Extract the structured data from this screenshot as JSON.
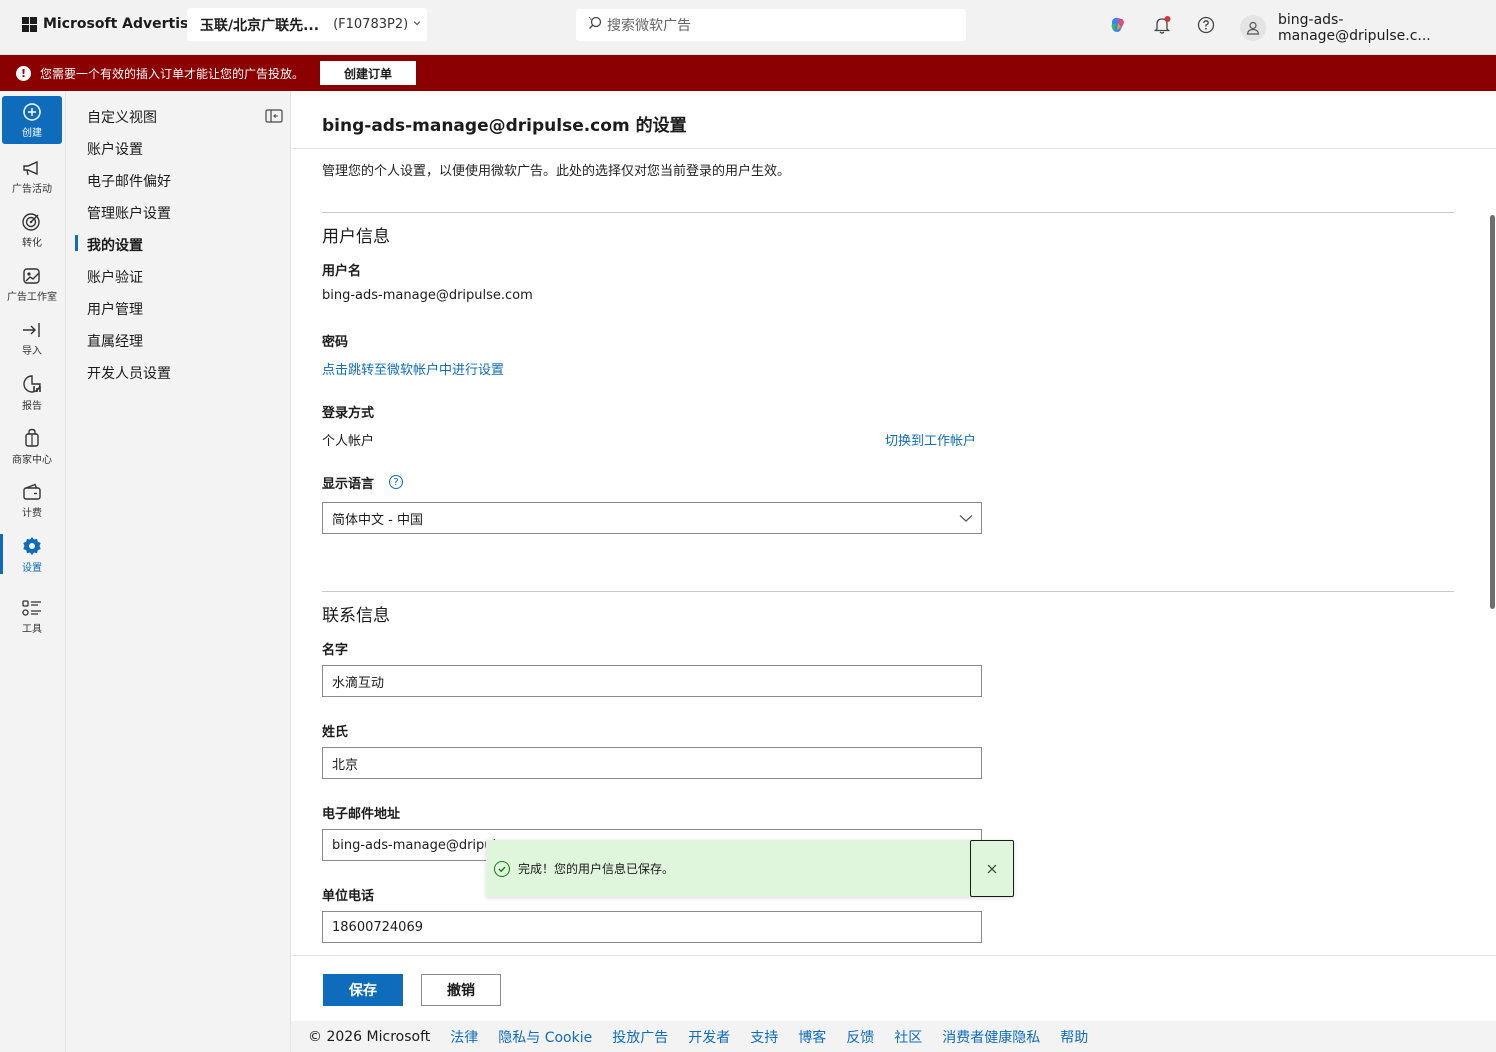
{
  "topbar": {
    "brand": "Microsoft Advertising",
    "account_name": "玉联/北京广联先...",
    "account_id": "(F10783P2)",
    "search_placeholder": "搜索微软广告",
    "user_email": "bing-ads-manage@dripulse.c..."
  },
  "alert": {
    "message": "您需要一个有效的插入订单才能让您的广告投放。",
    "button": "创建订单",
    "color": "#8b0000"
  },
  "rail": {
    "items": [
      {
        "label": "创建",
        "icon": "plus-circle-icon"
      },
      {
        "label": "广告活动",
        "icon": "megaphone-icon"
      },
      {
        "label": "转化",
        "icon": "target-icon"
      },
      {
        "label": "广告工作室",
        "icon": "studio-icon"
      },
      {
        "label": "导入",
        "icon": "import-icon"
      },
      {
        "label": "报告",
        "icon": "report-icon"
      },
      {
        "label": "商家中心",
        "icon": "shopping-bag-icon"
      },
      {
        "label": "计费",
        "icon": "wallet-icon"
      },
      {
        "label": "设置",
        "icon": "gear-icon"
      },
      {
        "label": "工具",
        "icon": "tools-icon"
      }
    ]
  },
  "subnav": {
    "items": [
      "自定义视图",
      "账户设置",
      "电子邮件偏好",
      "管理账户设置",
      "我的设置",
      "账户验证",
      "用户管理",
      "直属经理",
      "开发人员设置"
    ],
    "active": "我的设置"
  },
  "page": {
    "title": "bing-ads-manage@dripulse.com 的设置",
    "description": "管理您的个人设置，以便使用微软广告。此处的选择仅对您当前登录的用户生效。"
  },
  "user_info": {
    "section_title": "用户信息",
    "username_label": "用户名",
    "username_value": "bing-ads-manage@dripulse.com",
    "password_label": "密码",
    "password_link": "点击跳转至微软帐户中进行设置",
    "login_label": "登录方式",
    "login_value": "个人帐户",
    "login_switch": "切换到工作帐户",
    "language_label": "显示语言",
    "language_value": "简体中文 - 中国"
  },
  "contact_info": {
    "section_title": "联系信息",
    "first_name_label": "名字",
    "first_name_value": "水滴互动",
    "last_name_label": "姓氏",
    "last_name_value": "北京",
    "email_label": "电子邮件地址",
    "email_value": "bing-ads-manage@dripulse.com",
    "phone_label": "单位电话",
    "phone_value": "18600724069"
  },
  "toast": {
    "message": "完成！您的用户信息已保存。"
  },
  "actions": {
    "save": "保存",
    "cancel": "撤销"
  },
  "footer": {
    "copyright": "© 2026 Microsoft",
    "links": [
      "法律",
      "隐私与 Cookie",
      "投放广告",
      "开发者",
      "支持",
      "博客",
      "反馈",
      "社区",
      "消费者健康隐私",
      "帮助"
    ]
  },
  "colors": {
    "accent": "#0f6cbd",
    "success_bg": "#dff6dd"
  }
}
